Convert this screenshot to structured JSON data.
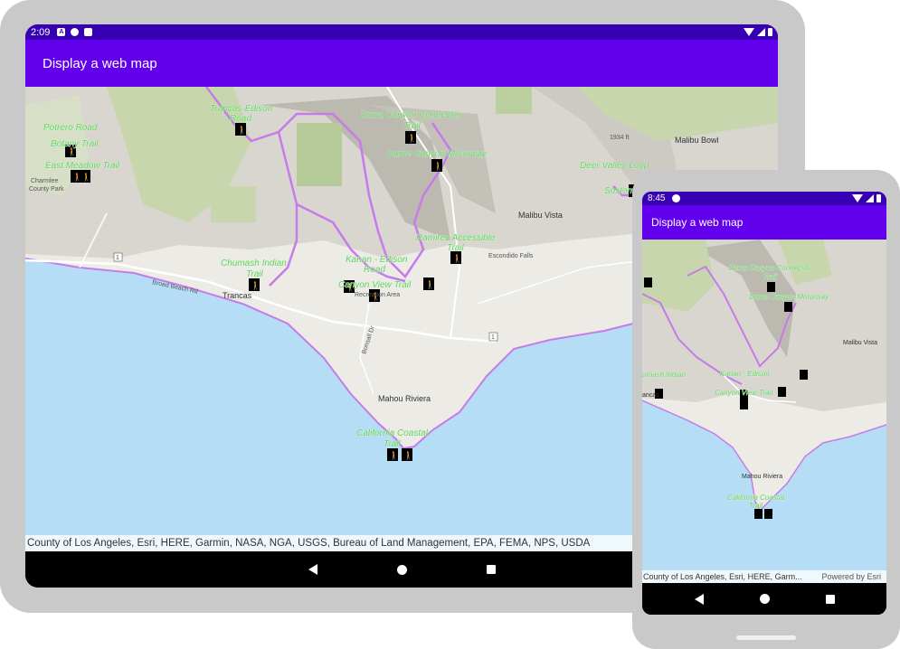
{
  "app_title": "Display a web map",
  "tablet": {
    "status_time": "2:09"
  },
  "phone": {
    "status_time": "8:45"
  },
  "attribution": "County of Los Angeles, Esri, HERE, Garmin, NASA, NGA, USGS, Bureau of Land Management, EPA, FEMA, NPS, USDA",
  "attribution_short": "County of Los Angeles, Esri, HERE, Garm...",
  "powered_by": "Powered by Esri",
  "map_labels": {
    "potrero_road": "Potrero Road",
    "botany_trail": "Botany Trail",
    "east_meadow_trail": "East Meadow Trail",
    "charmlee": "Charmlee",
    "county_park": "County Park",
    "trancas_edison_1": "Trancas-Edison",
    "trancas_edison_2": "Road",
    "zuma_connector_1": "Zuma Canyon Connector",
    "zuma_connector_2": "Trail",
    "dume_motorway": "Dume Canyon Motorway",
    "malibu_bowl": "Malibu Bowl",
    "deer_valley_loop": "Deer Valley Loop",
    "sostomo": "Sostomo",
    "malibu_vista": "Malibu Vista",
    "ramirez_1": "Ramirez Accessible",
    "ramirez_2": "Trail",
    "escondido_falls": "Escondido Falls",
    "chumash_1": "Chumash Indian",
    "chumash_2": "Trail",
    "kanan_edison_1": "Kanan - Edison",
    "kanan_edison_2": "Road",
    "canyon_view": "Canyon View Trail",
    "recreation_area": "Recreation Area",
    "broad_beach_rd": "Broad Beach Rd",
    "trancas": "Trancas",
    "bonsall_dr": "Bonsall Dr",
    "mahou_riviera": "Mahou Riviera",
    "california_coastal_1": "California Coastal",
    "california_coastal_2": "Trail",
    "route_1": "1",
    "elev_1934": "1934 ft",
    "ph_chumash": "umash Indian",
    "ph_trancas": "ancas",
    "ph_kanan": "Kanan - Edison",
    "ph_malibu_vista": "Malibu Vista"
  },
  "colors": {
    "status_bar": "#3700b3",
    "app_bar": "#6200ee",
    "ocean": "#b5def6",
    "land": "#ecebe6",
    "trail_line": "#c77be8",
    "trail_label": "#5fd35f"
  },
  "icons": [
    "hiker-icon",
    "back-icon",
    "home-icon",
    "recents-icon",
    "wifi-icon",
    "signal-icon",
    "battery-icon"
  ]
}
